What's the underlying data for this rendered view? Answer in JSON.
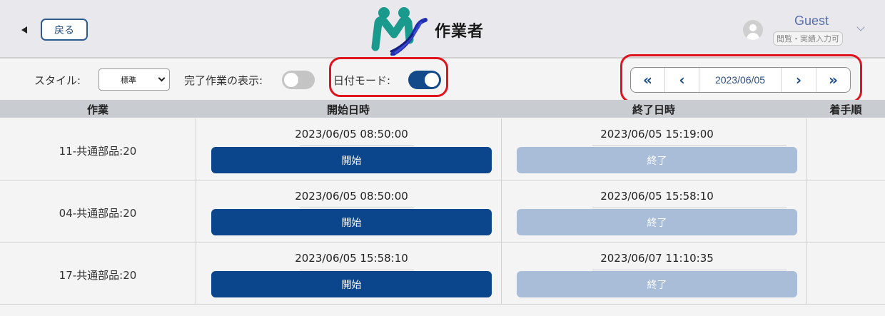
{
  "header": {
    "back_label": "戻る",
    "title": "作業者",
    "user_name": "Guest",
    "user_role": "閲覧・実績入力可"
  },
  "toolbar": {
    "style_label": "スタイル:",
    "style_value": "標準",
    "show_completed_label": "完了作業の表示:",
    "show_completed_on": false,
    "date_mode_label": "日付モード:",
    "date_mode_on": true,
    "date_nav": {
      "first": "«",
      "prev": "‹",
      "date": "2023/06/05",
      "next": "›",
      "last": "»"
    }
  },
  "table": {
    "columns": [
      "作業",
      "開始日時",
      "終了日時",
      "着手順"
    ],
    "rows": [
      {
        "task": "11-共通部品:20",
        "start": "2023/06/05 08:50:00",
        "start_btn": "開始",
        "end": "2023/06/05 15:19:00",
        "end_btn": "終了",
        "order": ""
      },
      {
        "task": "04-共通部品:20",
        "start": "2023/06/05 08:50:00",
        "start_btn": "開始",
        "end": "2023/06/05 15:58:10",
        "end_btn": "終了",
        "order": ""
      },
      {
        "task": "17-共通部品:20",
        "start": "2023/06/05 15:58:10",
        "start_btn": "開始",
        "end": "2023/06/07 11:10:35",
        "end_btn": "終了",
        "order": ""
      }
    ]
  },
  "colors": {
    "primary": "#0b468c",
    "disabled": "#a9bdd8",
    "highlight": "#e0141e"
  }
}
